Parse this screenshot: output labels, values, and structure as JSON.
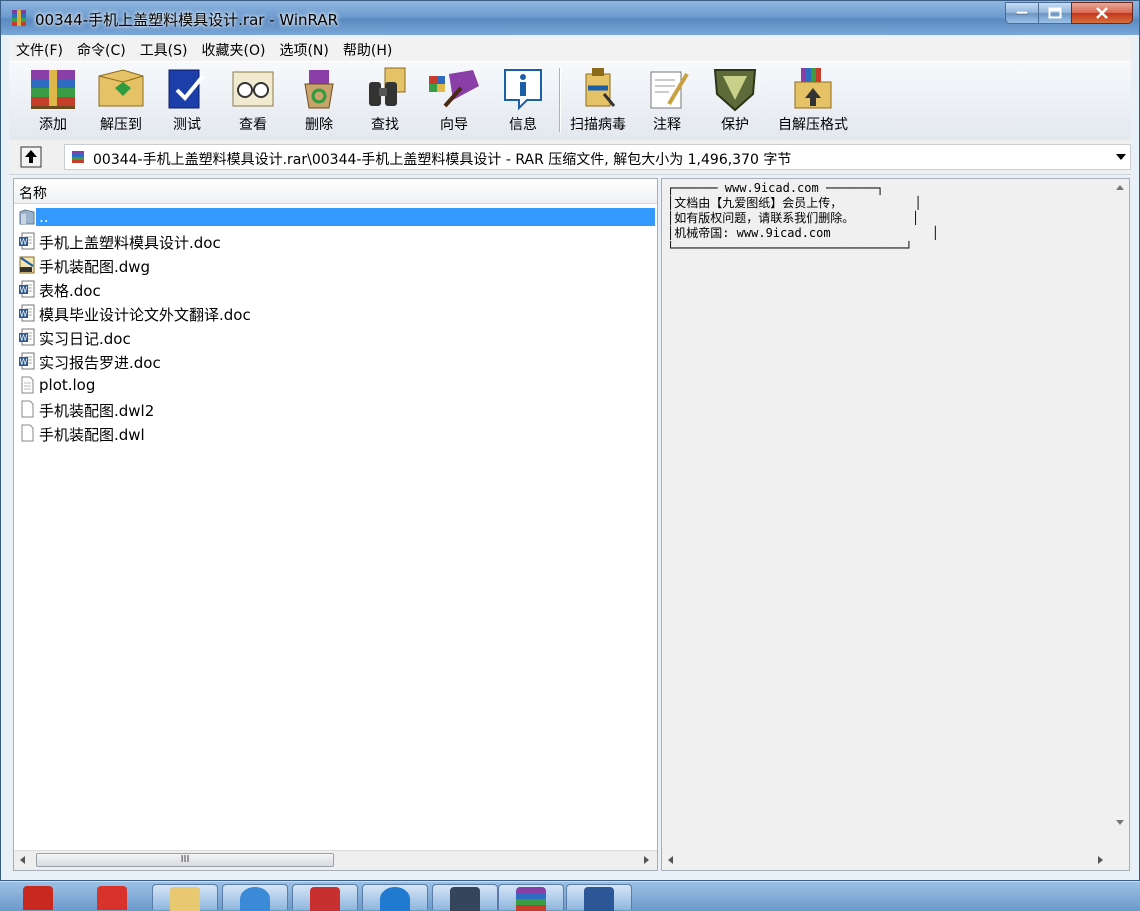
{
  "window": {
    "title": "00344-手机上盖塑料模具设计.rar - WinRAR"
  },
  "menu": [
    "文件(F)",
    "命令(C)",
    "工具(S)",
    "收藏夹(O)",
    "选项(N)",
    "帮助(H)"
  ],
  "toolbar": {
    "add": "添加",
    "extract": "解压到",
    "test": "测试",
    "view": "查看",
    "delete": "删除",
    "find": "查找",
    "wizard": "向导",
    "info": "信息",
    "virus": "扫描病毒",
    "comment": "注释",
    "protect": "保护",
    "sfx": "自解压格式"
  },
  "address": {
    "path": "00344-手机上盖塑料模具设计.rar\\00344-手机上盖塑料模具设计 - RAR 压缩文件, 解包大小为 1,496,370 字节"
  },
  "filelist": {
    "column_name": "名称",
    "items": [
      {
        "name": "..",
        "icon": "folder-up-icon"
      },
      {
        "name": "手机上盖塑料模具设计.doc",
        "icon": "word-doc-icon"
      },
      {
        "name": "手机装配图.dwg",
        "icon": "dwg-file-icon"
      },
      {
        "name": "表格.doc",
        "icon": "word-doc-icon"
      },
      {
        "name": "模具毕业设计论文外文翻译.doc",
        "icon": "word-doc-icon"
      },
      {
        "name": "实习日记.doc",
        "icon": "word-doc-icon"
      },
      {
        "name": "实习报告罗进.doc",
        "icon": "word-doc-icon"
      },
      {
        "name": "plot.log",
        "icon": "blank-file-icon"
      },
      {
        "name": "手机装配图.dwl2",
        "icon": "blank-file-icon"
      },
      {
        "name": "手机装配图.dwl",
        "icon": "blank-file-icon"
      }
    ],
    "scroll_grip": "III"
  },
  "comment": {
    "line1": "┌────── www.9icad.com ───────┐",
    "line2": "│文档由【九爱图纸】会员上传，          │",
    "line3": "│如有版权问题，请联系我们删除。        │",
    "line4": "│机械帝国: www.9icad.com              │",
    "line5": "└────────────────────────────────┘"
  },
  "colors": {
    "selection": "#3399ff",
    "titlebar": "#6e9ccf"
  }
}
